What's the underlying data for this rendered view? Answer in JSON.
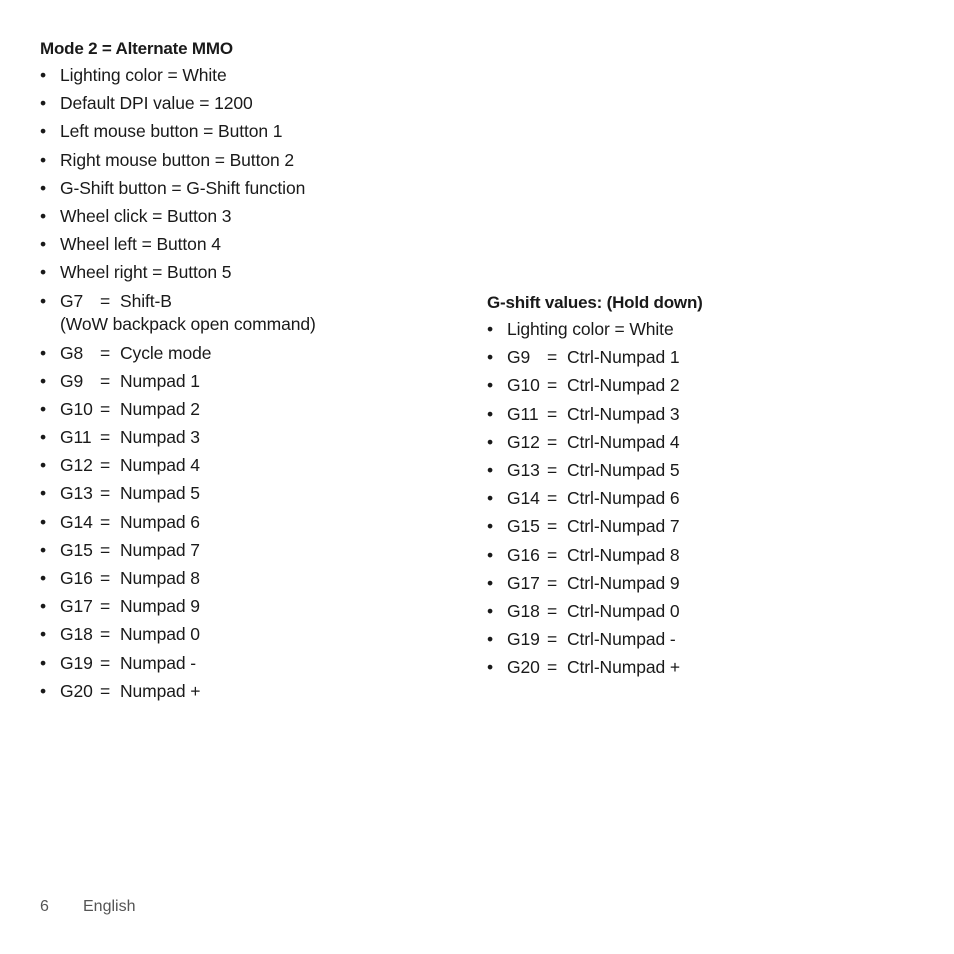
{
  "left_section": {
    "heading": "Mode 2 = Alternate MMO",
    "plain_items": [
      "Lighting color = White",
      "Default DPI value = 1200",
      "Left mouse button = Button 1",
      "Right mouse button = Button 2",
      "G-Shift button = G-Shift function",
      "Wheel click = Button 3",
      "Wheel left = Button 4",
      "Wheel right = Button 5"
    ],
    "g7": {
      "key": "G7",
      "eq": "=",
      "value": "Shift-B",
      "note": "(WoW backpack open command)"
    },
    "key_items": [
      {
        "key": "G8",
        "eq": "=",
        "value": "Cycle mode"
      },
      {
        "key": "G9",
        "eq": "=",
        "value": "Numpad 1"
      },
      {
        "key": "G10",
        "eq": "=",
        "value": "Numpad 2"
      },
      {
        "key": "G11",
        "eq": "=",
        "value": "Numpad 3"
      },
      {
        "key": "G12",
        "eq": "=",
        "value": "Numpad 4"
      },
      {
        "key": "G13",
        "eq": "=",
        "value": "Numpad 5"
      },
      {
        "key": "G14",
        "eq": "=",
        "value": "Numpad 6"
      },
      {
        "key": "G15",
        "eq": "=",
        "value": "Numpad 7"
      },
      {
        "key": "G16",
        "eq": "=",
        "value": "Numpad 8"
      },
      {
        "key": "G17",
        "eq": "=",
        "value": "Numpad 9"
      },
      {
        "key": "G18",
        "eq": "=",
        "value": "Numpad 0"
      },
      {
        "key": "G19",
        "eq": "=",
        "value": "Numpad -"
      },
      {
        "key": "G20",
        "eq": "=",
        "value": "Numpad +"
      }
    ]
  },
  "right_section": {
    "heading": "G-shift values: (Hold down)",
    "plain_items": [
      "Lighting color = White"
    ],
    "key_items": [
      {
        "key": "G9",
        "eq": "=",
        "value": "Ctrl-Numpad 1"
      },
      {
        "key": "G10",
        "eq": "=",
        "value": "Ctrl-Numpad 2"
      },
      {
        "key": "G11",
        "eq": "=",
        "value": "Ctrl-Numpad 3"
      },
      {
        "key": "G12",
        "eq": "=",
        "value": "Ctrl-Numpad 4"
      },
      {
        "key": "G13",
        "eq": "=",
        "value": "Ctrl-Numpad 5"
      },
      {
        "key": "G14",
        "eq": "=",
        "value": "Ctrl-Numpad 6"
      },
      {
        "key": "G15",
        "eq": "=",
        "value": "Ctrl-Numpad 7"
      },
      {
        "key": "G16",
        "eq": "=",
        "value": "Ctrl-Numpad 8"
      },
      {
        "key": "G17",
        "eq": "=",
        "value": "Ctrl-Numpad 9"
      },
      {
        "key": "G18",
        "eq": "=",
        "value": "Ctrl-Numpad 0"
      },
      {
        "key": "G19",
        "eq": "=",
        "value": "Ctrl-Numpad -"
      },
      {
        "key": "G20",
        "eq": "=",
        "value": "Ctrl-Numpad +"
      }
    ]
  },
  "footer": {
    "page_number": "6",
    "language": "English"
  },
  "bullet_glyph": "•"
}
